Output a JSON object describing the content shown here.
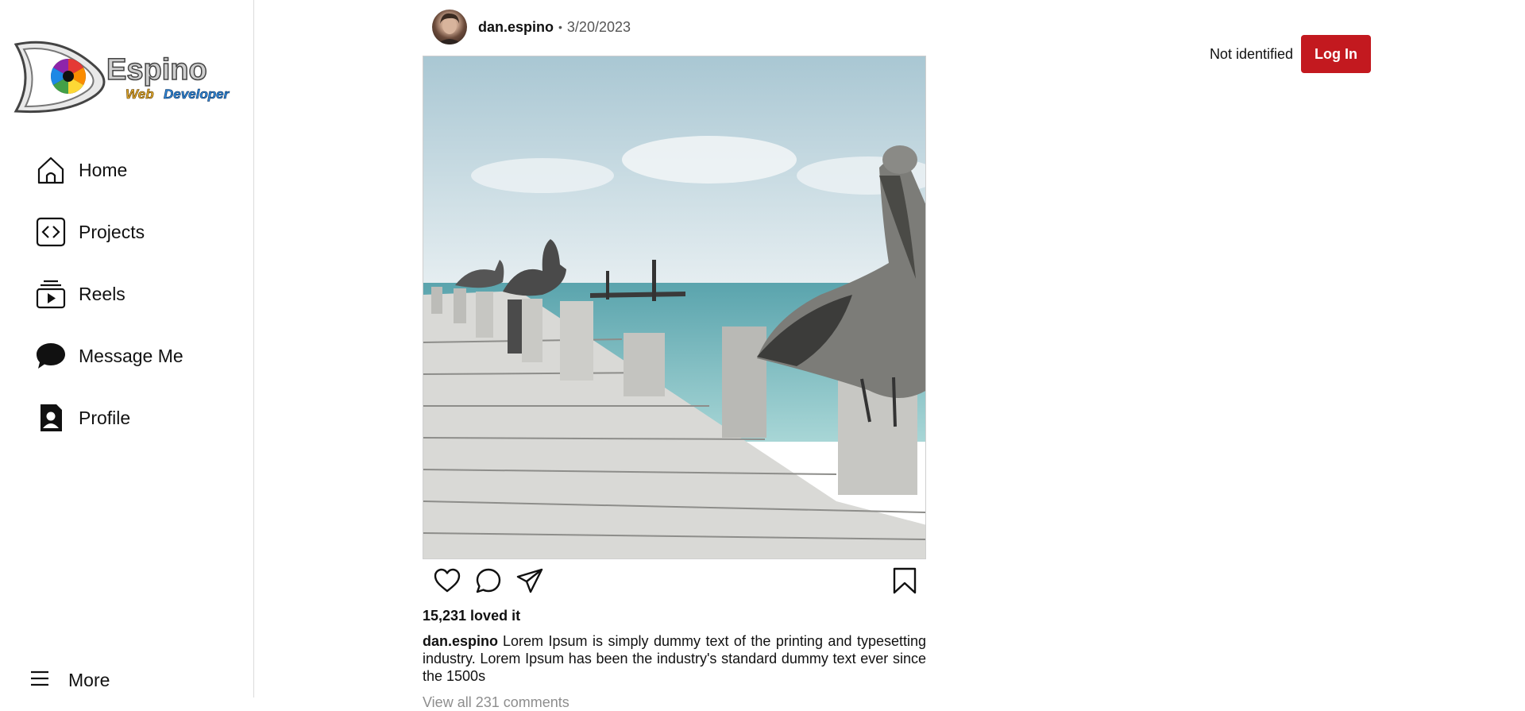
{
  "logo": {
    "wordmark": "Espino",
    "sub_web": "Web",
    "sub_dev": "Developer"
  },
  "nav": [
    {
      "label": "Home",
      "icon": "home-icon"
    },
    {
      "label": "Projects",
      "icon": "code-icon"
    },
    {
      "label": "Reels",
      "icon": "reels-icon"
    },
    {
      "label": "Message Me",
      "icon": "chat-bubble-icon"
    },
    {
      "label": "Profile",
      "icon": "profile-icon"
    }
  ],
  "more": {
    "label": "More",
    "icon": "hamburger-menu-icon"
  },
  "post": {
    "username": "dan.espino",
    "separator": "•",
    "date": "3/20/2023",
    "likes": "15,231 loved it",
    "caption_user": "dan.espino",
    "caption_text": "Lorem Ipsum is simply dummy text of the printing and typesetting industry. Lorem Ipsum has been the industry's standard dummy text ever since the 1500s",
    "view_all": "View all 231 comments",
    "actions": [
      "heart-icon",
      "comment-icon",
      "share-icon",
      "bookmark-icon"
    ]
  },
  "auth": {
    "status": "Not identified",
    "login_label": "Log In"
  },
  "colors": {
    "accent": "#c3191f",
    "border": "#dbdbdb"
  }
}
